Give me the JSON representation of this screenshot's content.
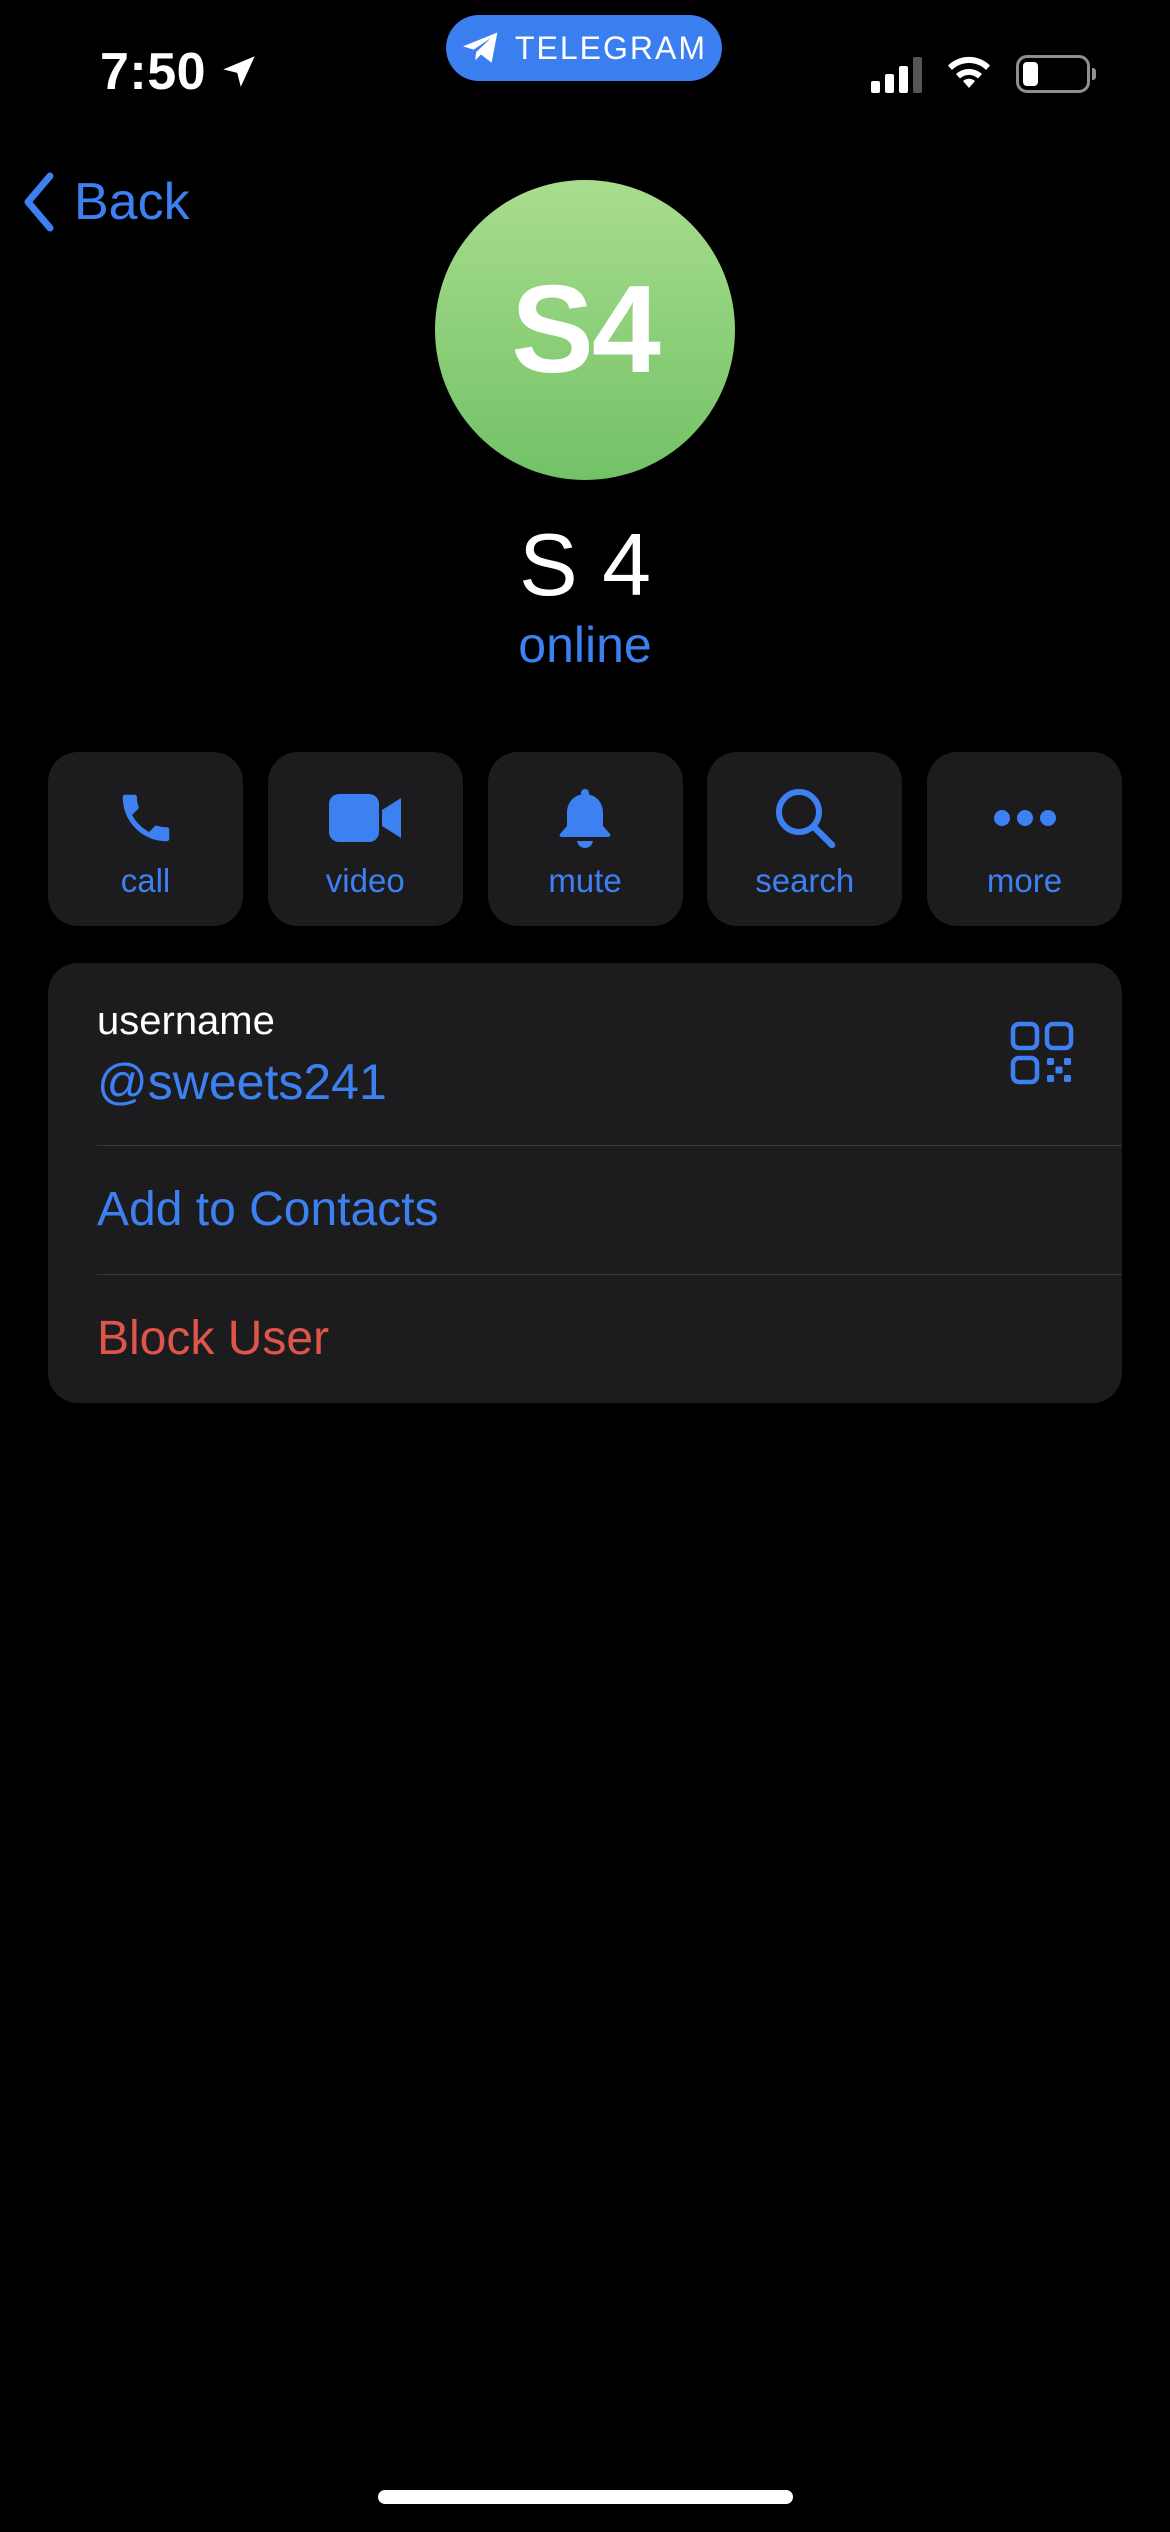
{
  "status_bar": {
    "time": "7:50",
    "location_icon": "location-arrow-icon",
    "app_pill_label": "TELEGRAM",
    "app_pill_icon": "telegram-plane-icon",
    "signal_icon": "cellular-signal-icon",
    "wifi_icon": "wifi-icon",
    "battery_icon": "battery-icon",
    "battery_level": 0.2
  },
  "nav": {
    "back_label": "Back",
    "back_icon": "chevron-left-icon"
  },
  "profile": {
    "avatar_initials": "S4",
    "name": "S 4",
    "status": "online"
  },
  "actions": [
    {
      "label": "call",
      "icon": "phone-icon"
    },
    {
      "label": "video",
      "icon": "video-camera-icon"
    },
    {
      "label": "mute",
      "icon": "bell-icon"
    },
    {
      "label": "search",
      "icon": "search-icon"
    },
    {
      "label": "more",
      "icon": "ellipsis-icon"
    }
  ],
  "info": {
    "username_label": "username",
    "username_value": "@sweets241",
    "qr_icon": "qr-code-icon",
    "add_contact_label": "Add to Contacts",
    "block_label": "Block User"
  },
  "colors": {
    "background": "#000000",
    "card": "#1c1c1e",
    "accent": "#3d80f2",
    "destructive": "#e0554a",
    "avatar_top": "#a9dd8e",
    "avatar_bottom": "#72c266"
  }
}
